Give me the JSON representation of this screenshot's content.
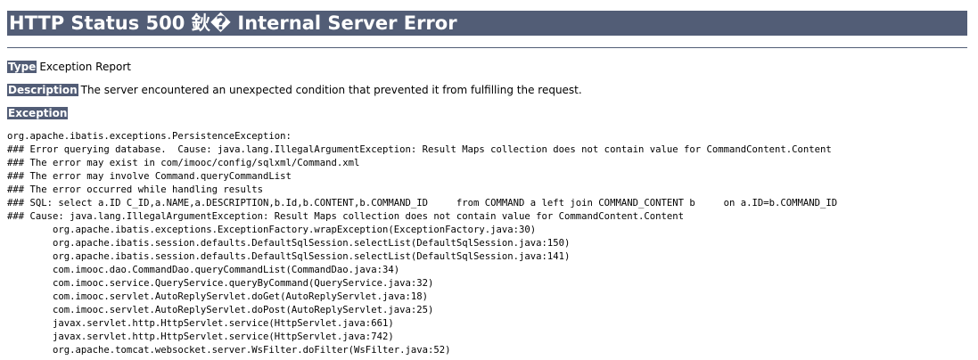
{
  "title": "HTTP Status 500 鈥� Internal Server Error",
  "type": {
    "label": "Type",
    "value": "Exception Report"
  },
  "description": {
    "label": "Description",
    "value": "The server encountered an unexpected condition that prevented it from fulfilling the request."
  },
  "exception": {
    "label": "Exception",
    "lines": [
      "org.apache.ibatis.exceptions.PersistenceException:",
      "### Error querying database.  Cause: java.lang.IllegalArgumentException: Result Maps collection does not contain value for CommandContent.Content",
      "### The error may exist in com/imooc/config/sqlxml/Command.xml",
      "### The error may involve Command.queryCommandList",
      "### The error occurred while handling results",
      "### SQL: select a.ID C_ID,a.NAME,a.DESCRIPTION,b.Id,b.CONTENT,b.COMMAND_ID     from COMMAND a left join COMMAND_CONTENT b     on a.ID=b.COMMAND_ID",
      "### Cause: java.lang.IllegalArgumentException: Result Maps collection does not contain value for CommandContent.Content",
      "\torg.apache.ibatis.exceptions.ExceptionFactory.wrapException(ExceptionFactory.java:30)",
      "\torg.apache.ibatis.session.defaults.DefaultSqlSession.selectList(DefaultSqlSession.java:150)",
      "\torg.apache.ibatis.session.defaults.DefaultSqlSession.selectList(DefaultSqlSession.java:141)",
      "\tcom.imooc.dao.CommandDao.queryCommandList(CommandDao.java:34)",
      "\tcom.imooc.service.QueryService.queryByCommand(QueryService.java:32)",
      "\tcom.imooc.servlet.AutoReplyServlet.doGet(AutoReplyServlet.java:18)",
      "\tcom.imooc.servlet.AutoReplyServlet.doPost(AutoReplyServlet.java:25)",
      "\tjavax.servlet.http.HttpServlet.service(HttpServlet.java:661)",
      "\tjavax.servlet.http.HttpServlet.service(HttpServlet.java:742)",
      "\torg.apache.tomcat.websocket.server.WsFilter.doFilter(WsFilter.java:52)"
    ]
  },
  "colors": {
    "header_bg": "#525d76",
    "header_text": "#ffffff",
    "body_text": "#000000",
    "page_bg": "#ffffff"
  }
}
